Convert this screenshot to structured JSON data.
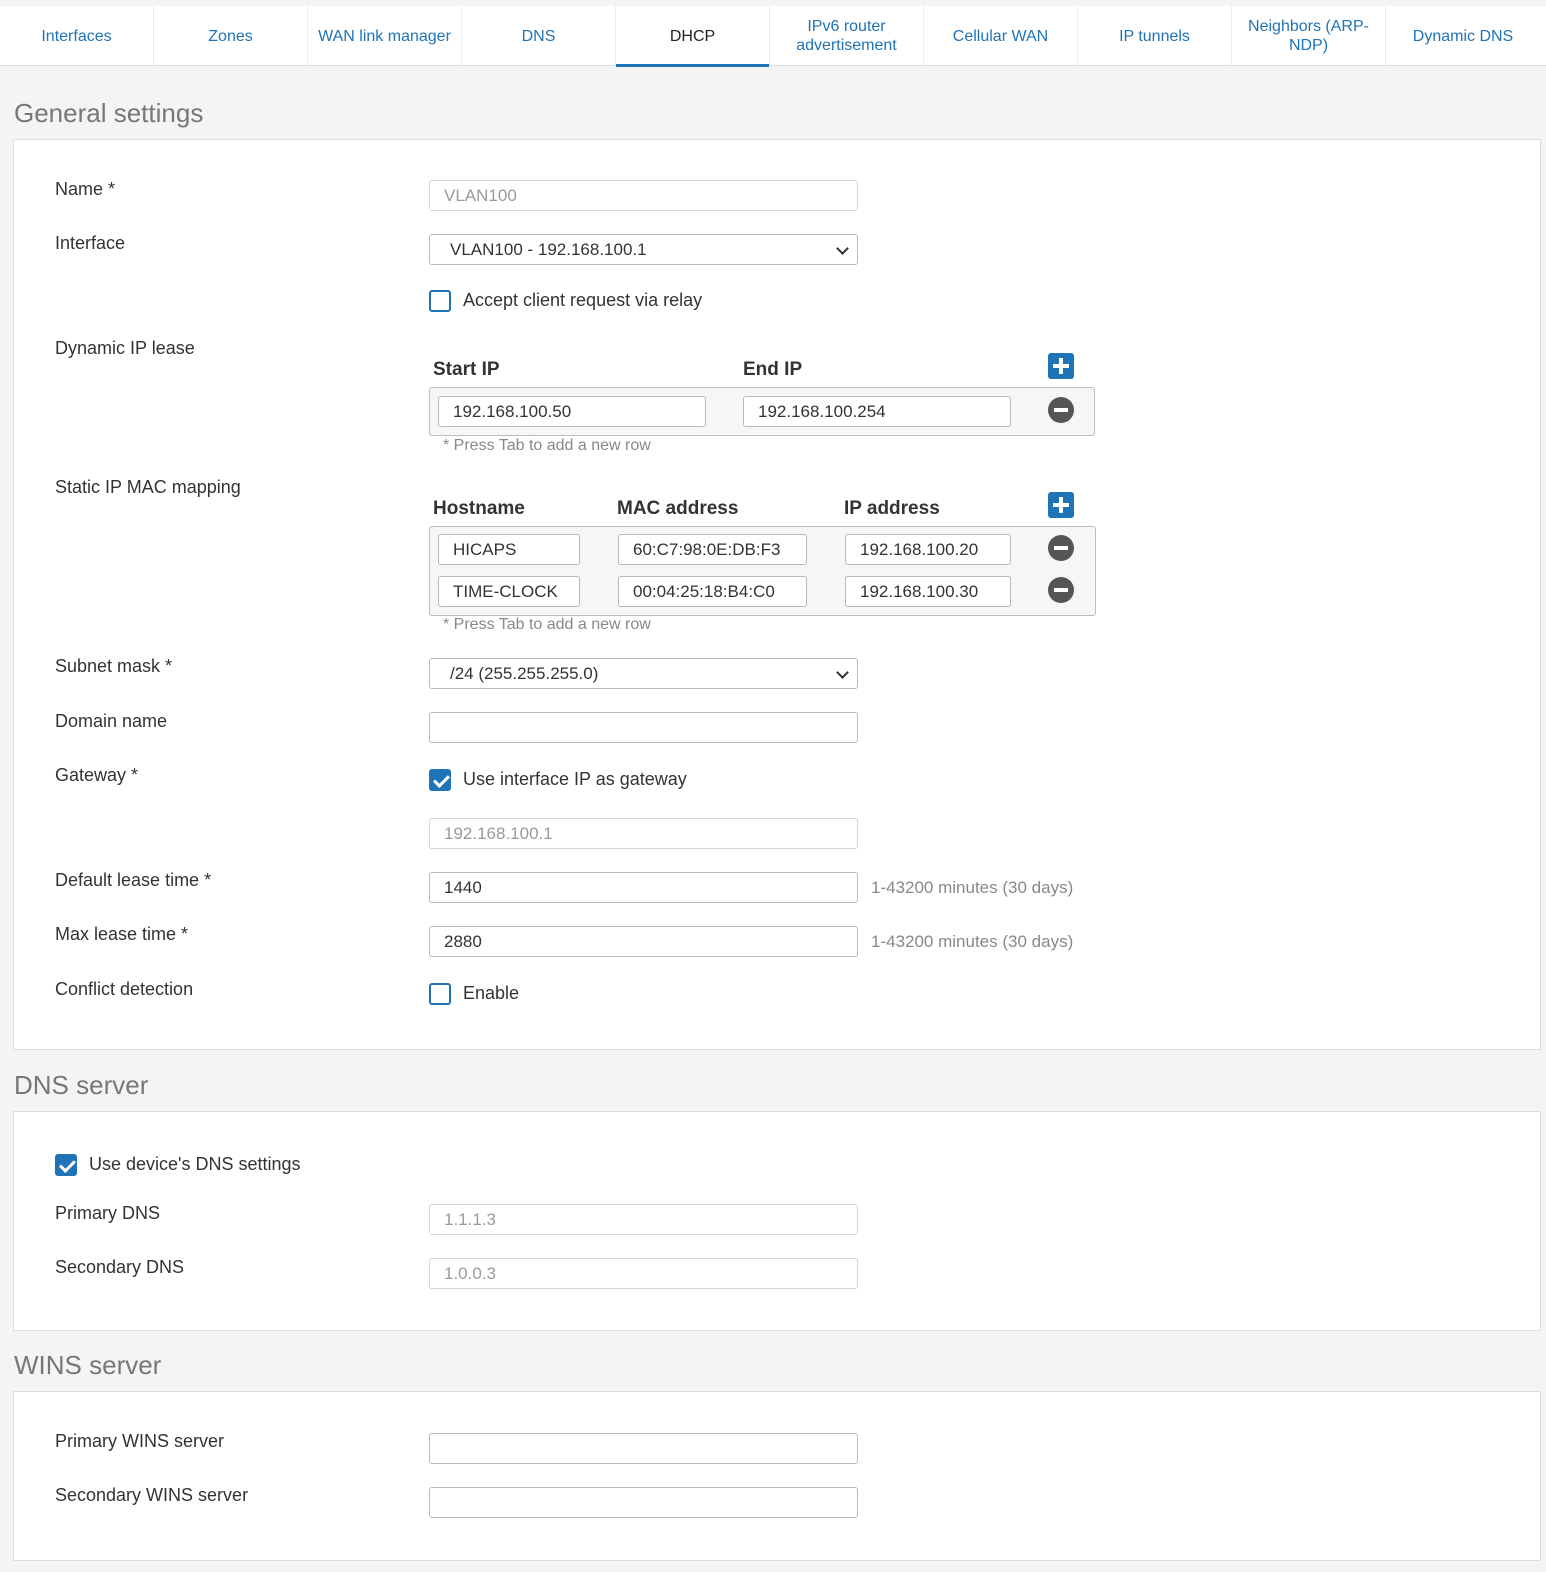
{
  "tabs": [
    "Interfaces",
    "Zones",
    "WAN link manager",
    "DNS",
    "DHCP",
    "IPv6 router advertisement",
    "Cellular WAN",
    "IP tunnels",
    "Neighbors (ARP-NDP)",
    "Dynamic DNS"
  ],
  "active_tab": "DHCP",
  "accent_color": "#1f73b7",
  "general": {
    "title": "General settings",
    "name_label": "Name *",
    "name_value": "VLAN100",
    "interface_label": "Interface",
    "interface_value": "VLAN100 - 192.168.100.1",
    "relay_label": "Accept client request via relay",
    "relay_checked": false,
    "dynamic_label": "Dynamic IP lease",
    "start_ip_head": "Start IP",
    "end_ip_head": "End IP",
    "start_ip": "192.168.100.50",
    "end_ip": "192.168.100.254",
    "tab_hint": "* Press Tab to add a new row",
    "static_label": "Static IP MAC mapping",
    "hostname_head": "Hostname",
    "mac_head": "MAC address",
    "ip_head": "IP address",
    "mappings": [
      {
        "hostname": "HICAPS",
        "mac": "60:C7:98:0E:DB:F3",
        "ip": "192.168.100.20"
      },
      {
        "hostname": "TIME-CLOCK",
        "mac": "00:04:25:18:B4:C0",
        "ip": "192.168.100.30"
      }
    ],
    "subnet_label": "Subnet mask *",
    "subnet_value": "/24 (255.255.255.0)",
    "domain_label": "Domain name",
    "domain_value": "",
    "gateway_label": "Gateway *",
    "gateway_cb_label": "Use interface IP as gateway",
    "gateway_checked": true,
    "gateway_value": "192.168.100.1",
    "default_lease_label": "Default lease time *",
    "default_lease_value": "1440",
    "max_lease_label": "Max lease time *",
    "max_lease_value": "2880",
    "lease_help": "1-43200 minutes (30 days)",
    "conflict_label": "Conflict detection",
    "conflict_cb_label": "Enable",
    "conflict_checked": false
  },
  "dns": {
    "title": "DNS server",
    "use_device_label": "Use device's DNS settings",
    "use_device_checked": true,
    "primary_label": "Primary DNS",
    "primary_value": "1.1.1.3",
    "secondary_label": "Secondary DNS",
    "secondary_value": "1.0.0.3"
  },
  "wins": {
    "title": "WINS server",
    "primary_label": "Primary WINS server",
    "primary_value": "",
    "secondary_label": "Secondary WINS server",
    "secondary_value": ""
  }
}
